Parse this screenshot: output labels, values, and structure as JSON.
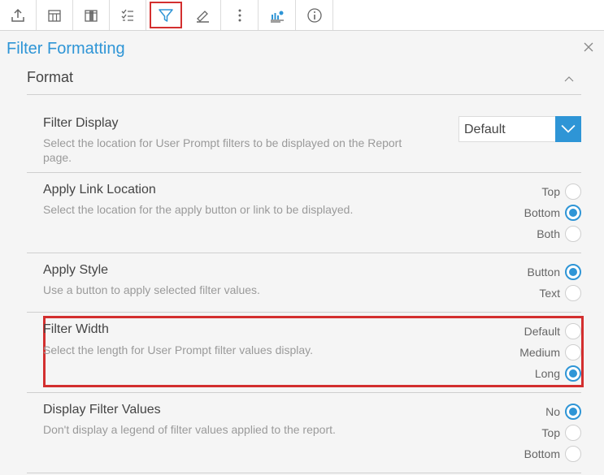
{
  "toolbar": {
    "icons": [
      "export-icon",
      "table-icon",
      "columns-icon",
      "list-check-icon",
      "filter-icon",
      "brush-icon",
      "more-vertical-icon",
      "chart-settings-icon",
      "info-icon"
    ],
    "active": "filter-icon"
  },
  "panel": {
    "title": "Filter Formatting",
    "section": "Format"
  },
  "rows": {
    "filter_display": {
      "title": "Filter Display",
      "desc": "Select the location for User Prompt filters to be displayed on the Report page.",
      "value": "Default"
    },
    "apply_link_location": {
      "title": "Apply Link Location",
      "desc": "Select the location for the apply button or link to be displayed.",
      "options": [
        "Top",
        "Bottom",
        "Both"
      ],
      "selected": "Bottom"
    },
    "apply_style": {
      "title": "Apply Style",
      "desc": "Use a button to apply selected filter values.",
      "options": [
        "Button",
        "Text"
      ],
      "selected": "Button"
    },
    "filter_width": {
      "title": "Filter Width",
      "desc": "Select the length for User Prompt filter values display.",
      "options": [
        "Default",
        "Medium",
        "Long"
      ],
      "selected": "Long"
    },
    "display_filter_values": {
      "title": "Display Filter Values",
      "desc": "Don't display a legend of filter values applied to the report.",
      "options": [
        "No",
        "Top",
        "Bottom"
      ],
      "selected": "No"
    }
  },
  "colors": {
    "accent": "#2e95d6",
    "highlight": "#d32f2f"
  }
}
